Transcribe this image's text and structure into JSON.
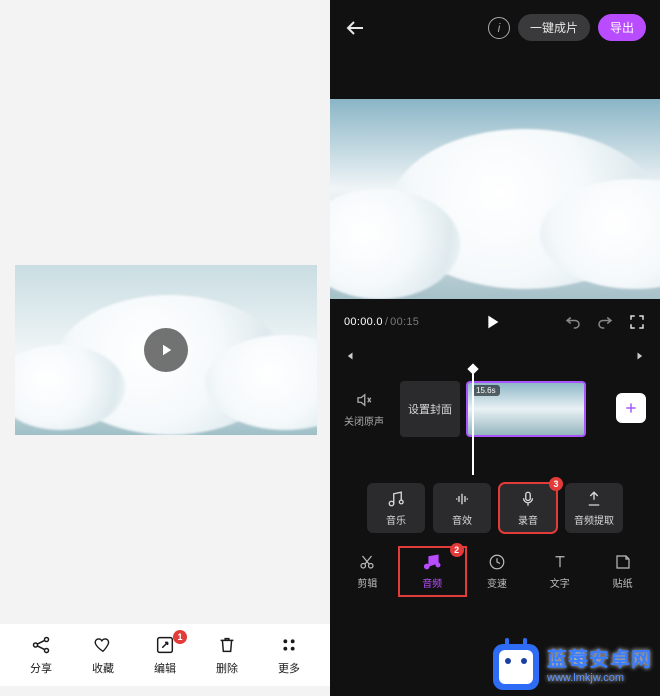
{
  "left": {
    "toolbar": {
      "share": {
        "label": "分享"
      },
      "favorite": {
        "label": "收藏"
      },
      "edit": {
        "label": "编辑",
        "badge": "1"
      },
      "delete": {
        "label": "删除"
      },
      "more": {
        "label": "更多"
      }
    }
  },
  "right": {
    "header": {
      "one_click_label": "一键成片",
      "export_label": "导出",
      "info_label": "i"
    },
    "playbar": {
      "time_current": "00:00.0",
      "time_sep": " / ",
      "time_total": "00:15"
    },
    "timeline": {
      "mute_label": "关闭原声",
      "set_cover_label": "设置封面",
      "clip_duration": "15.6s"
    },
    "mid_actions": {
      "music": {
        "label": "音乐"
      },
      "soundfx": {
        "label": "音效"
      },
      "record": {
        "label": "录音",
        "badge": "3"
      },
      "extract": {
        "label": "音频提取"
      }
    },
    "tabs": {
      "cut": {
        "label": "剪辑"
      },
      "audio": {
        "label": "音频",
        "badge": "2"
      },
      "speed": {
        "label": "变速"
      },
      "text": {
        "label": "文字"
      },
      "sticker": {
        "label": "贴纸"
      }
    }
  },
  "watermark": {
    "title": "蓝莓安卓网",
    "url": "www.lmkjw.com"
  }
}
